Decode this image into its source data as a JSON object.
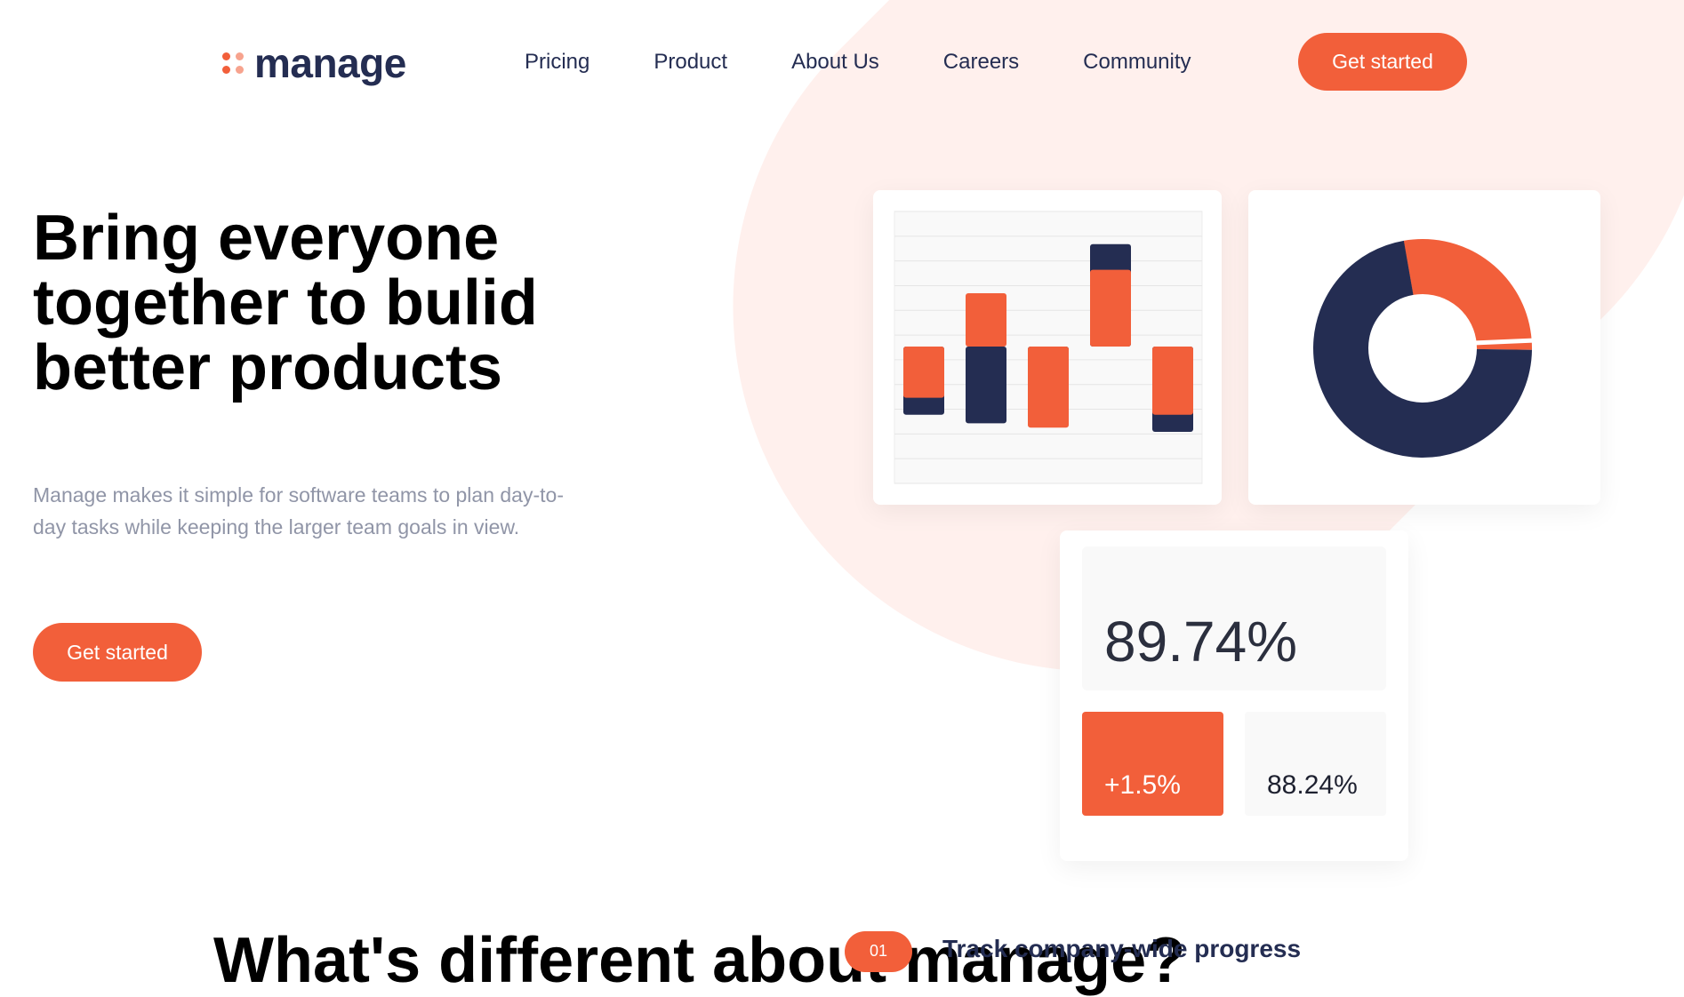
{
  "brand": {
    "name": "manage",
    "accent": "#f25f3a",
    "navy": "#242d52",
    "blob": "#fff0ed"
  },
  "nav": {
    "links": [
      "Pricing",
      "Product",
      "About Us",
      "Careers",
      "Community"
    ],
    "cta": "Get started"
  },
  "hero": {
    "title": "Bring everyone together to bulid better products",
    "subtitle": "Manage makes it simple for software teams to plan day-to-day tasks while keeping the larger team goals in view.",
    "cta": "Get started"
  },
  "stats": {
    "main": "89.74%",
    "change": "+1.5%",
    "secondary": "88.24%"
  },
  "chart_data": [
    {
      "type": "bar",
      "series": [
        {
          "color": "#f25f3a",
          "values": [
            -1.2,
            1.25,
            -1.9,
            1.8,
            -1.6
          ]
        },
        {
          "color": "#242d52",
          "values": [
            -1.6,
            -1.8,
            -1.2,
            2.4,
            -2.0
          ]
        }
      ]
    },
    {
      "type": "pie",
      "values": [
        28,
        72
      ],
      "colors": [
        "#f25f3a",
        "#242d52"
      ]
    }
  ],
  "bottom": {
    "heading": "What's different about manage?",
    "badge": "01",
    "feature": "Track company-wide progress"
  }
}
